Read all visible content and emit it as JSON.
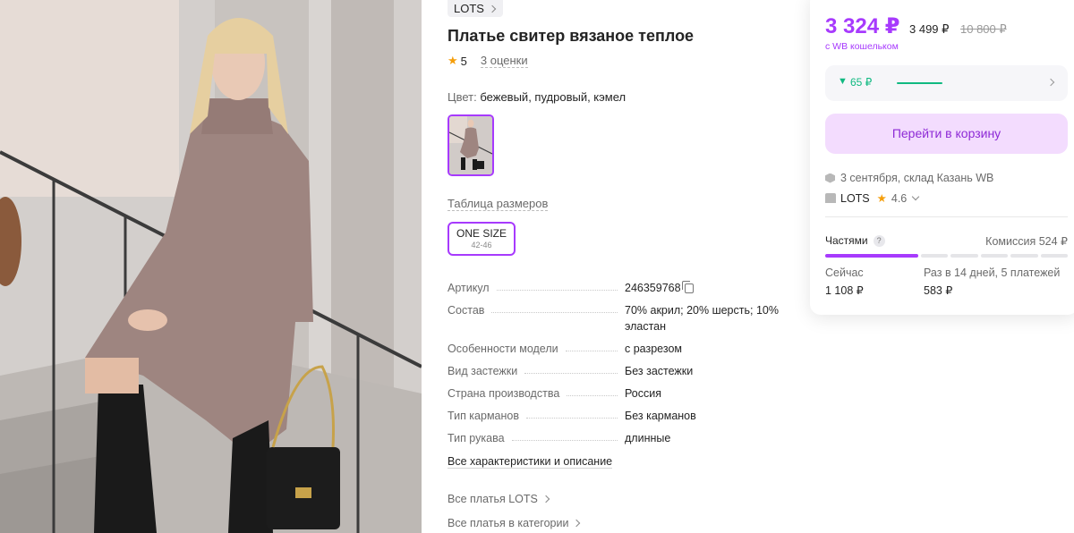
{
  "product": {
    "brand": "LOTS",
    "title": "Платье свитер вязаное теплое",
    "rating": "5",
    "reviews": "3 оценки",
    "color_label": "Цвет:",
    "color_value": "бежевый, пудровый, кэмел",
    "size_table_link": "Таблица размеров",
    "size": {
      "name": "ONE SIZE",
      "range": "42-46"
    }
  },
  "params": [
    {
      "key": "Артикул",
      "value": "246359768",
      "copy": true
    },
    {
      "key": "Состав",
      "value": "70% акрил; 20% шерсть; 10% эластан"
    },
    {
      "key": "Особенности модели",
      "value": "с разрезом"
    },
    {
      "key": "Вид застежки",
      "value": "Без застежки"
    },
    {
      "key": "Страна производства",
      "value": "Россия"
    },
    {
      "key": "Тип карманов",
      "value": "Без карманов"
    },
    {
      "key": "Тип рукава",
      "value": "длинные"
    }
  ],
  "all_characteristics": "Все характеристики и описание",
  "links": {
    "brand_dresses": "Все платья LOTS",
    "category_dresses": "Все платья в категории"
  },
  "card": {
    "price": "3 324 ₽",
    "price_regular": "3 499 ₽",
    "price_old": "10 800 ₽",
    "wallet_note": "с WB кошельком",
    "cashback": "65 ₽",
    "cart_button": "Перейти в корзину",
    "delivery": "3 сентября, склад Казань WB",
    "seller": "LOTS",
    "seller_rating": "4.6",
    "installment": {
      "label": "Частями",
      "help": "?",
      "commission": "Комиссия 524 ₽",
      "now_label": "Сейчас",
      "now_value": "1 108 ₽",
      "later_label": "Раз в 14 дней, 5 платежей",
      "later_value": "583 ₽",
      "paid_parts": 1,
      "total_parts": 6
    }
  },
  "colors": {
    "accent": "#a73afd",
    "cart_bg": "#f3dcfe",
    "cashback": "#10b981",
    "star": "#f59e0b"
  },
  "icons": [
    "chevron-right-icon",
    "star-icon",
    "copy-icon",
    "box-icon",
    "shop-icon",
    "chevron-down-icon",
    "help-icon",
    "arrow-down-icon"
  ]
}
